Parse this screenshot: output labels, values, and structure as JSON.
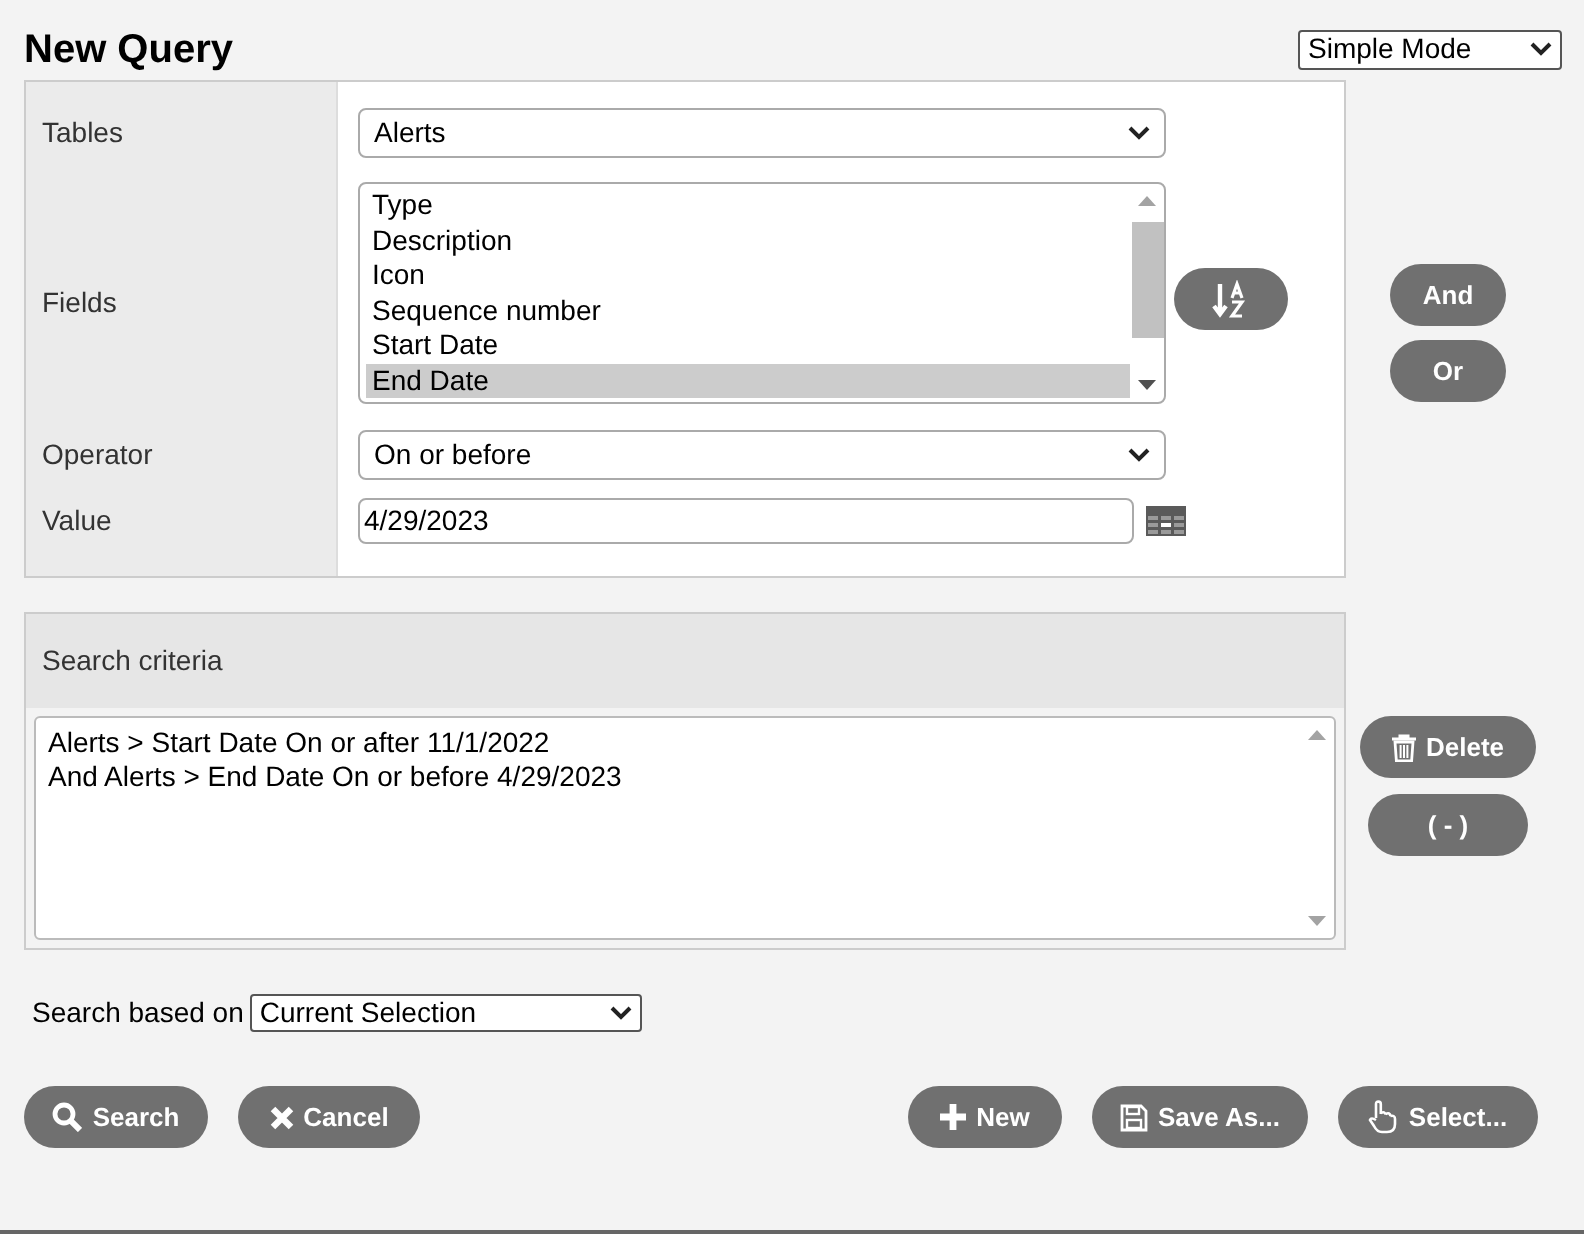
{
  "title": "New Query",
  "mode_select": {
    "value": "Simple Mode"
  },
  "form_rows": [
    {
      "kind": "select",
      "label": "Tables",
      "value": "Alerts"
    },
    {
      "kind": "listbox",
      "label": "Fields",
      "items": [
        {
          "text": "Type",
          "selected": false
        },
        {
          "text": "Description",
          "selected": false
        },
        {
          "text": "Icon",
          "selected": false
        },
        {
          "text": "Sequence number",
          "selected": false
        },
        {
          "text": "Start Date",
          "selected": false
        },
        {
          "text": "End Date",
          "selected": true
        }
      ]
    },
    {
      "kind": "select",
      "label": "Operator",
      "value": "On or before"
    },
    {
      "kind": "date",
      "label": "Value",
      "value": "4/29/2023"
    }
  ],
  "logic_buttons": [
    "And",
    "Or"
  ],
  "criteria": {
    "header": "Search criteria",
    "lines": [
      "Alerts > Start Date On or after 11/1/2022",
      "And Alerts > End Date On or before 4/29/2023"
    ]
  },
  "criteria_buttons": [
    {
      "kind": "delete",
      "label": "Delete"
    },
    {
      "kind": "plain",
      "label": "( - )"
    }
  ],
  "search_based_on": {
    "label": "Search based on",
    "value": "Current Selection"
  },
  "actions_left": [
    {
      "kind": "search",
      "label": "Search"
    },
    {
      "kind": "cancel",
      "label": "Cancel"
    }
  ],
  "actions_right": [
    {
      "kind": "new",
      "label": "New"
    },
    {
      "kind": "save",
      "label": "Save As..."
    },
    {
      "kind": "select",
      "label": "Select..."
    }
  ]
}
